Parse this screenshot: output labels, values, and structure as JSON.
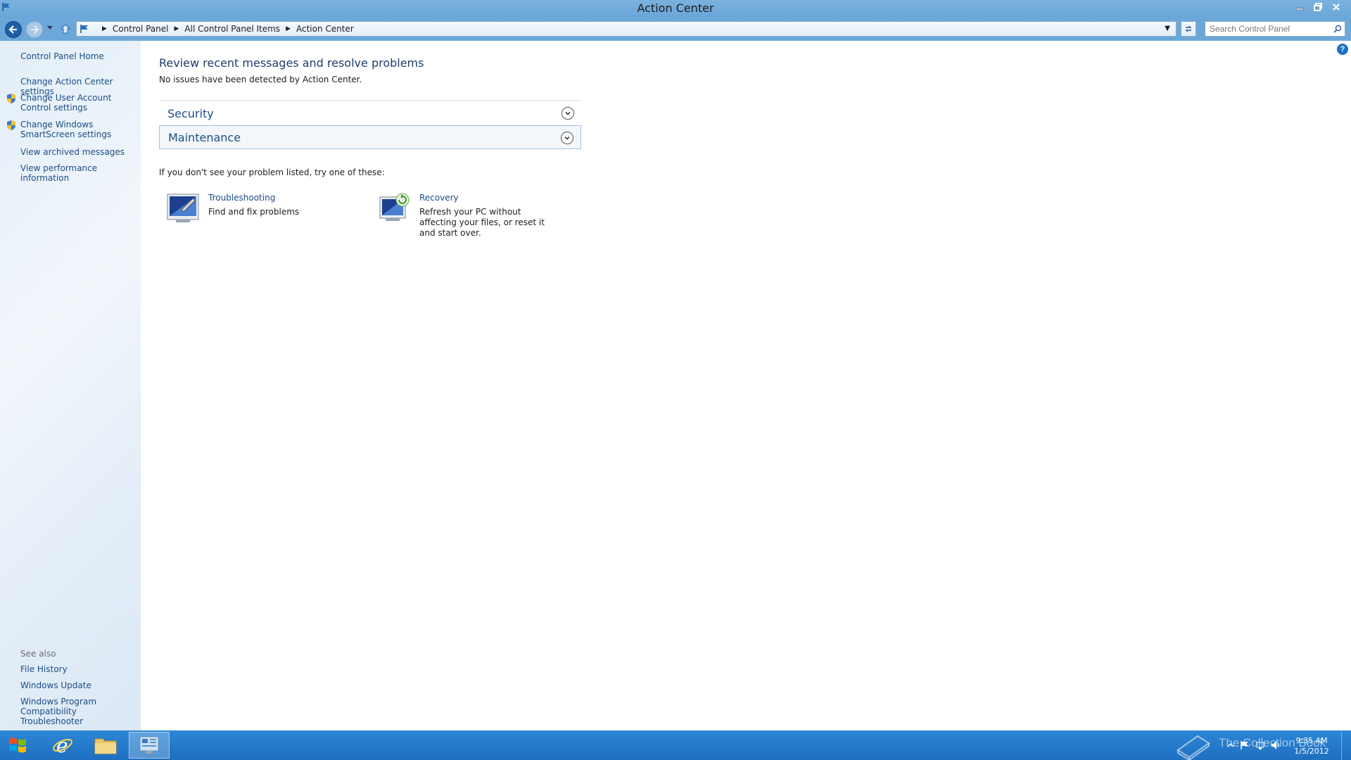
{
  "window": {
    "title": "Action Center"
  },
  "address_bar": {
    "breadcrumbs": [
      "Control Panel",
      "All Control Panel Items",
      "Action Center"
    ],
    "search_placeholder": "Search Control Panel"
  },
  "left_pane": {
    "links": [
      {
        "label": "Control Panel Home",
        "shield": false
      },
      {
        "label": "Change Action Center settings",
        "shield": false
      },
      {
        "label": "Change User Account Control settings",
        "shield": true
      },
      {
        "label": "Change Windows SmartScreen settings",
        "shield": true
      },
      {
        "label": "View archived messages",
        "shield": false
      },
      {
        "label": "View performance information",
        "shield": false
      }
    ],
    "see_also_label": "See also",
    "see_also": [
      {
        "label": "File History"
      },
      {
        "label": "Windows Update"
      },
      {
        "label": "Windows Program Compatibility Troubleshooter"
      }
    ]
  },
  "main": {
    "title": "Review recent messages and resolve problems",
    "subtitle": "No issues have been detected by Action Center.",
    "sections": [
      {
        "label": "Security",
        "expanded": false
      },
      {
        "label": "Maintenance",
        "expanded": false
      }
    ],
    "hint": "If you don't see your problem listed, try one of these:",
    "tools": [
      {
        "name": "Troubleshooting",
        "description": "Find and fix problems"
      },
      {
        "name": "Recovery",
        "description": "Refresh your PC without affecting your files, or reset it and start over."
      }
    ]
  },
  "taskbar": {
    "watermark": "The Collection Book",
    "clock_time": "9:35 AM",
    "clock_date": "1/5/2012"
  },
  "colors": {
    "titlebar": "#6aa7d9",
    "link": "#1a4d86",
    "taskbar": "#1f6fc0"
  }
}
